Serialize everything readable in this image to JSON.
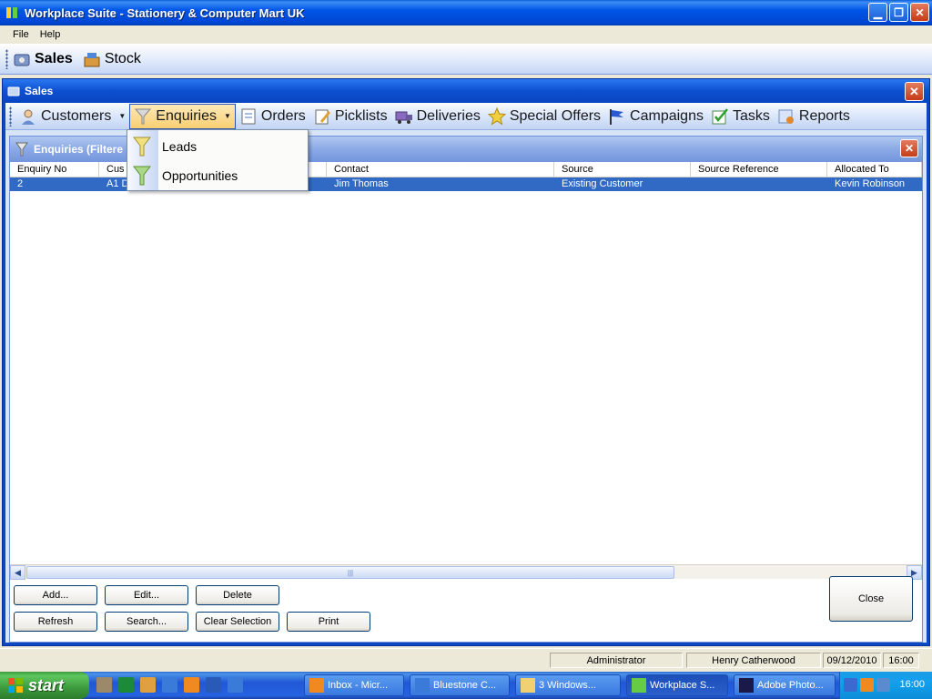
{
  "window": {
    "title": "Workplace Suite - Stationery & Computer Mart UK"
  },
  "menubar": {
    "items": [
      "File",
      "Help"
    ]
  },
  "app_toolbar": {
    "items": [
      {
        "label": "Sales",
        "icon": "sales-icon"
      },
      {
        "label": "Stock",
        "icon": "stock-icon"
      }
    ]
  },
  "sales_window": {
    "title": "Sales"
  },
  "module_toolbar": {
    "items": [
      {
        "label": "Customers",
        "icon": "customers-icon"
      },
      {
        "label": "Enquiries",
        "icon": "funnel-icon"
      },
      {
        "label": "Orders",
        "icon": "orders-icon"
      },
      {
        "label": "Picklists",
        "icon": "picklists-icon"
      },
      {
        "label": "Deliveries",
        "icon": "truck-icon"
      },
      {
        "label": "Special Offers",
        "icon": "star-icon"
      },
      {
        "label": "Campaigns",
        "icon": "flag-icon"
      },
      {
        "label": "Tasks",
        "icon": "checkbox-icon"
      },
      {
        "label": "Reports",
        "icon": "reports-icon"
      }
    ]
  },
  "enquiries_dropdown": {
    "items": [
      "Leads",
      "Opportunities"
    ]
  },
  "enquiries_window": {
    "title": "Enquiries (Filtere",
    "columns": [
      "Enquiry No",
      "Cus",
      "",
      "Contact",
      "Source",
      "Source Reference",
      "Allocated To"
    ],
    "rows": [
      {
        "enquiry_no": "2",
        "customer": "A1 D",
        "contact": "Jim Thomas",
        "source": "Existing Customer",
        "source_reference": "",
        "allocated_to": "Kevin  Robinson"
      }
    ],
    "buttons": {
      "add": "Add...",
      "edit": "Edit...",
      "delete": "Delete",
      "refresh": "Refresh",
      "search": "Search...",
      "clear_selection": "Clear Selection",
      "print": "Print",
      "close": "Close"
    }
  },
  "statusbar": {
    "role": "Administrator",
    "user": "Henry Catherwood",
    "date": "09/12/2010",
    "time": "16:00"
  },
  "taskbar": {
    "start": "start",
    "tasks": [
      "Inbox - Micr...",
      "Bluestone C...",
      "3 Windows...",
      "Workplace S...",
      "Adobe Photo..."
    ],
    "clock": "16:00"
  },
  "colors": {
    "accent": "#0c48c2",
    "selection": "#316ac5",
    "start_green": "#3c9a3c"
  }
}
